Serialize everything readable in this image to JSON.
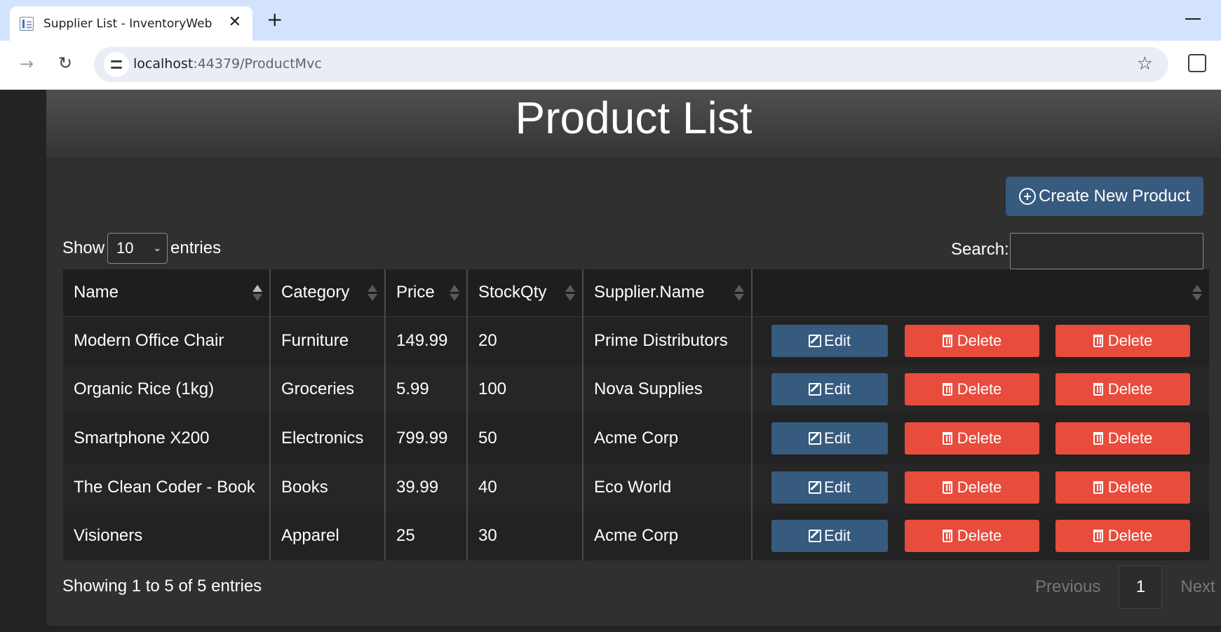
{
  "browser": {
    "tab_title": "Supplier List - InventoryWeb",
    "url_host": "localhost",
    "url_rest": ":44379/ProductMvc"
  },
  "page": {
    "title": "Product List",
    "create_button": "Create New Product",
    "show_label": "Show",
    "page_size": "10",
    "entries_label": "entries",
    "search_label": "Search:",
    "search_value": ""
  },
  "table": {
    "headers": [
      "Name",
      "Category",
      "Price",
      "StockQty",
      "Supplier.Name",
      ""
    ],
    "rows": [
      [
        "Modern Office Chair",
        "Furniture",
        "149.99",
        "20",
        "Prime Distributors"
      ],
      [
        "Organic Rice (1kg)",
        "Groceries",
        "5.99",
        "100",
        "Nova Supplies"
      ],
      [
        "Smartphone X200",
        "Electronics",
        "799.99",
        "50",
        "Acme Corp"
      ],
      [
        "The Clean Coder - Book",
        "Books",
        "39.99",
        "40",
        "Eco World"
      ],
      [
        "Visioners",
        "Apparel",
        "25",
        "30",
        "Acme Corp"
      ]
    ],
    "edit_label": "Edit",
    "delete_label": "Delete"
  },
  "footer": {
    "info": "Showing 1 to 5 of 5 entries",
    "previous": "Previous",
    "current_page": "1",
    "next": "Next"
  },
  "colors": {
    "primary": "#375a7f",
    "danger": "#e74c3c"
  }
}
